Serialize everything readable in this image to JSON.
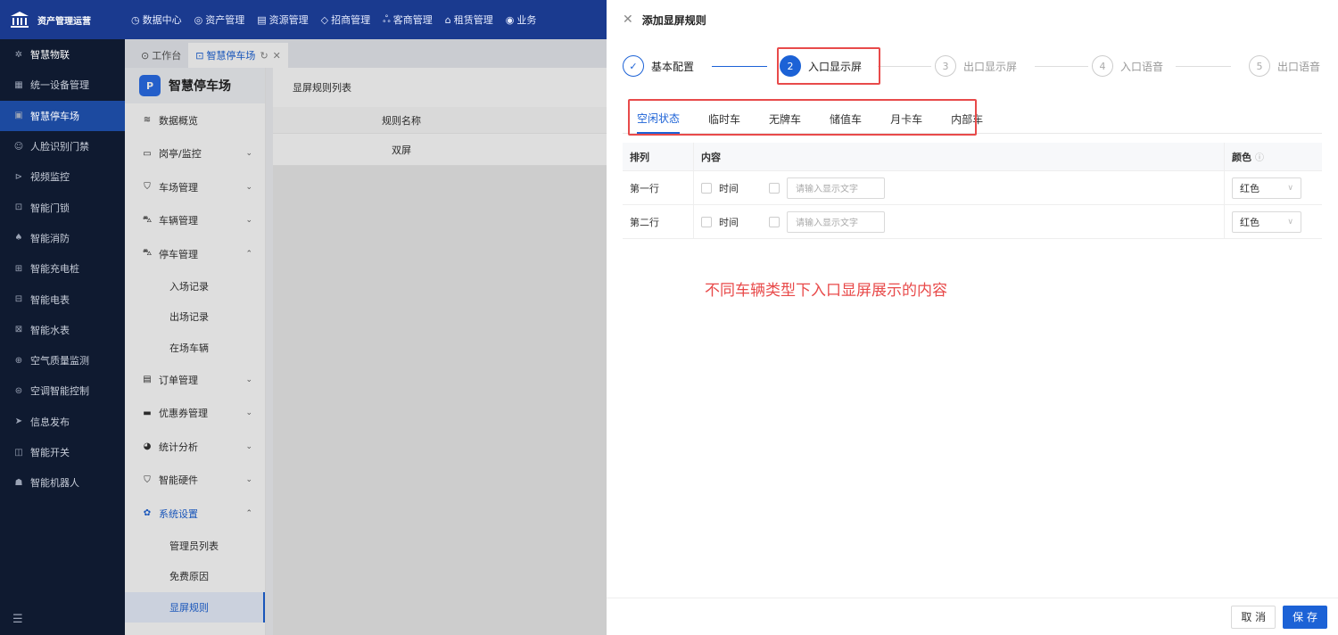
{
  "app": {
    "title": "资产管理运营"
  },
  "topnav": [
    {
      "label": "数据中心",
      "icon": "clock-icon"
    },
    {
      "label": "资产管理",
      "icon": "box-icon"
    },
    {
      "label": "资源管理",
      "icon": "document-icon"
    },
    {
      "label": "招商管理",
      "icon": "tag-icon"
    },
    {
      "label": "客商管理",
      "icon": "users-icon"
    },
    {
      "label": "租赁管理",
      "icon": "building-icon"
    },
    {
      "label": "业务",
      "icon": "circle-icon"
    }
  ],
  "leftnav": [
    {
      "label": "智慧物联"
    },
    {
      "label": "统一设备管理"
    },
    {
      "label": "智慧停车场"
    },
    {
      "label": "人脸识别门禁"
    },
    {
      "label": "视频监控"
    },
    {
      "label": "智能门锁"
    },
    {
      "label": "智能消防"
    },
    {
      "label": "智能充电桩"
    },
    {
      "label": "智能电表"
    },
    {
      "label": "智能水表"
    },
    {
      "label": "空气质量监测"
    },
    {
      "label": "空调智能控制"
    },
    {
      "label": "信息发布"
    },
    {
      "label": "智能开关"
    },
    {
      "label": "智能机器人"
    }
  ],
  "tabs": [
    {
      "label": "工作台"
    },
    {
      "label": "智慧停车场"
    }
  ],
  "section": {
    "title": "智慧停车场",
    "items": [
      {
        "label": "数据概览"
      },
      {
        "label": "岗亭/监控"
      },
      {
        "label": "车场管理"
      },
      {
        "label": "车辆管理"
      },
      {
        "label": "停车管理"
      },
      {
        "label": "入场记录"
      },
      {
        "label": "出场记录"
      },
      {
        "label": "在场车辆"
      },
      {
        "label": "订单管理"
      },
      {
        "label": "优惠券管理"
      },
      {
        "label": "统计分析"
      },
      {
        "label": "智能硬件"
      },
      {
        "label": "系统设置"
      },
      {
        "label": "管理员列表"
      },
      {
        "label": "免费原因"
      },
      {
        "label": "显屏规则"
      }
    ]
  },
  "list": {
    "title": "显屏规则列表",
    "col_name": "规则名称",
    "rows": [
      {
        "name": "双屏"
      }
    ]
  },
  "drawer": {
    "title": "添加显屏规则",
    "steps": [
      {
        "num": "1",
        "label": "基本配置"
      },
      {
        "num": "2",
        "label": "入口显示屏"
      },
      {
        "num": "3",
        "label": "出口显示屏"
      },
      {
        "num": "4",
        "label": "入口语音"
      },
      {
        "num": "5",
        "label": "出口语音"
      }
    ],
    "vehicle_tabs": [
      "空闲状态",
      "临时车",
      "无牌车",
      "储值车",
      "月卡车",
      "内部车"
    ],
    "table": {
      "h_row": "排列",
      "h_content": "内容",
      "h_color": "颜色",
      "rows": [
        {
          "row": "第一行",
          "time_label": "时间",
          "placeholder": "请输入显示文字",
          "color": "红色"
        },
        {
          "row": "第二行",
          "time_label": "时间",
          "placeholder": "请输入显示文字",
          "color": "红色"
        }
      ]
    },
    "annotation": "不同车辆类型下入口显屏展示的内容",
    "cancel": "取 消",
    "save": "保 存"
  },
  "colors": {
    "primary": "#1c62d6",
    "topbar": "#1a3a8f",
    "sidebar": "#0f1a30",
    "annotation": "#e84a4a"
  }
}
